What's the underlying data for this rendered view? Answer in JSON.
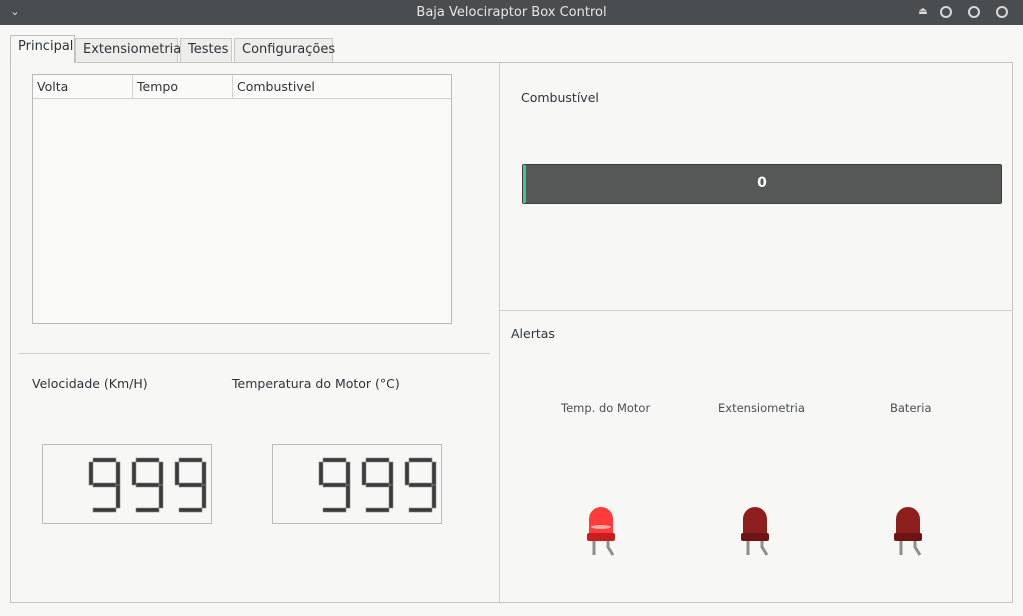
{
  "window": {
    "title": "Baja Velociraptor Box Control"
  },
  "tabs": [
    "Principal",
    "Extensiometria",
    "Testes",
    "Configurações"
  ],
  "table": {
    "columns": [
      "Volta",
      "Tempo",
      "Combustivel"
    ],
    "rows": []
  },
  "speed": {
    "label": "Velocidade (Km/H)",
    "value": "999"
  },
  "engine_temp": {
    "label": "Temperatura do Motor (°C)",
    "value": "999"
  },
  "fuel": {
    "label": "Combustível",
    "value_text": "0",
    "fraction": 0.0,
    "bar_color": "#3cc59a"
  },
  "alerts": {
    "title": "Alertas",
    "items": [
      {
        "label": "Temp. do Motor",
        "state": "on",
        "color": "#ff3b3b"
      },
      {
        "label": "Extensiometria",
        "state": "off",
        "color": "#8e1f1f"
      },
      {
        "label": "Bateria",
        "state": "off",
        "color": "#8e1f1f"
      }
    ]
  }
}
